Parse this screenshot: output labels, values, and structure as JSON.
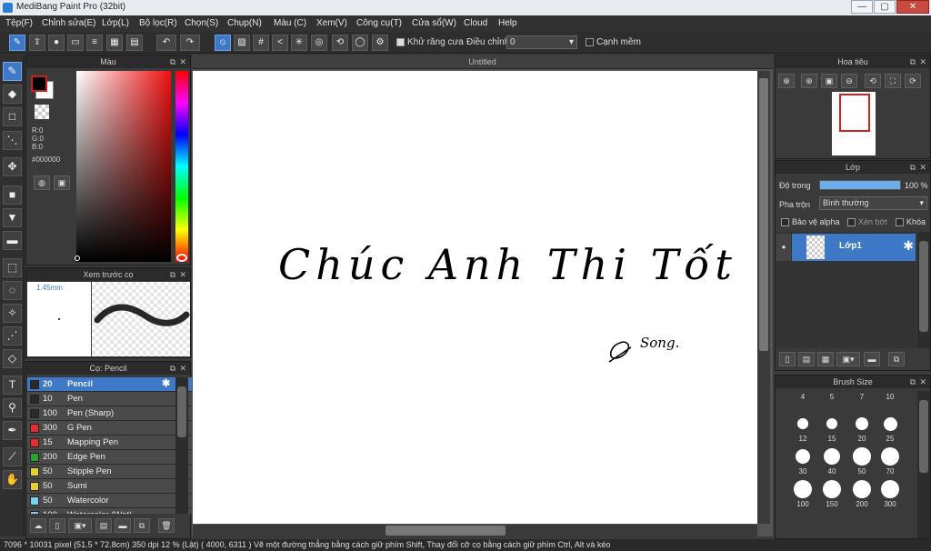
{
  "window": {
    "title": "MediBang Paint Pro (32bit)",
    "min": "—",
    "max": "▢",
    "close": "✕"
  },
  "menu": [
    "Tệp(F)",
    "Chỉnh sửa(E)",
    "Lớp(L)",
    "Bộ lọc(R)",
    "Chọn(S)",
    "Chụp(N)",
    "Màu (C)",
    "Xem(V)",
    "Công cụ(T)",
    "Cửa sổ(W)",
    "Cloud",
    "Help"
  ],
  "toolbar": {
    "antialias_label": "Khử răng cưa",
    "adjust_label": "Điều chỉnh",
    "adjust_value": "0",
    "soft_edge_label": "Cạnh mềm"
  },
  "color_panel": {
    "title": "Màu",
    "r": "R:0",
    "g": "G:0",
    "b": "B:0",
    "hex": "#000000",
    "fg_color": "#000000",
    "bg_color": "#ffffff"
  },
  "preview_panel": {
    "title": "Xem trước cọ",
    "size": "1.45mm"
  },
  "brush_panel": {
    "title": "Cọ: Pencil",
    "brushes": [
      {
        "size": "20",
        "name": "Pencil",
        "color": "#2a2a2a",
        "selected": true
      },
      {
        "size": "10",
        "name": "Pen",
        "color": "#2a2a2a"
      },
      {
        "size": "100",
        "name": "Pen (Sharp)",
        "color": "#2a2a2a"
      },
      {
        "size": "300",
        "name": "G Pen",
        "color": "#e03030"
      },
      {
        "size": "15",
        "name": "Mapping Pen",
        "color": "#e03030"
      },
      {
        "size": "200",
        "name": "Edge Pen",
        "color": "#30a030"
      },
      {
        "size": "50",
        "name": "Stipple Pen",
        "color": "#e6d030"
      },
      {
        "size": "50",
        "name": "Sumi",
        "color": "#e6d030"
      },
      {
        "size": "50",
        "name": "Watercolor",
        "color": "#7ed0f0"
      },
      {
        "size": "100",
        "name": "Watercolor (Wet)",
        "color": "#7ed0f0"
      }
    ]
  },
  "canvas": {
    "tab": "Untitled",
    "text_main": "Chúc Anh Thi Tốt",
    "text_sign": "Song."
  },
  "navigator": {
    "title": "Hoa tiêu"
  },
  "layer_panel": {
    "title": "Lớp",
    "opacity_label": "Độ trong",
    "opacity_value": "100 %",
    "opacity_fraction": 1.0,
    "blend_label": "Pha trộn",
    "blend_value": "Bình thường",
    "protect_alpha": "Bảo vệ alpha",
    "clipping": "Xén bớt",
    "lock": "Khóa",
    "layers": [
      {
        "name": "Lớp1"
      }
    ]
  },
  "brush_size_panel": {
    "title": "Brush Size",
    "sizes": [
      "4",
      "5",
      "7",
      "10",
      "12",
      "15",
      "20",
      "25",
      "30",
      "40",
      "50",
      "70",
      "100",
      "150",
      "200",
      "300"
    ]
  },
  "status": "7096 * 10031 pixel   (51.5 * 72.8cm)   350 dpi   12 % (Lật)   ( 4000, 6311 )   Vẽ một đường thẳng bằng cách giữ phím Shift, Thay đổi cỡ cọ bằng cách giữ phím Ctrl, Alt và kéo"
}
